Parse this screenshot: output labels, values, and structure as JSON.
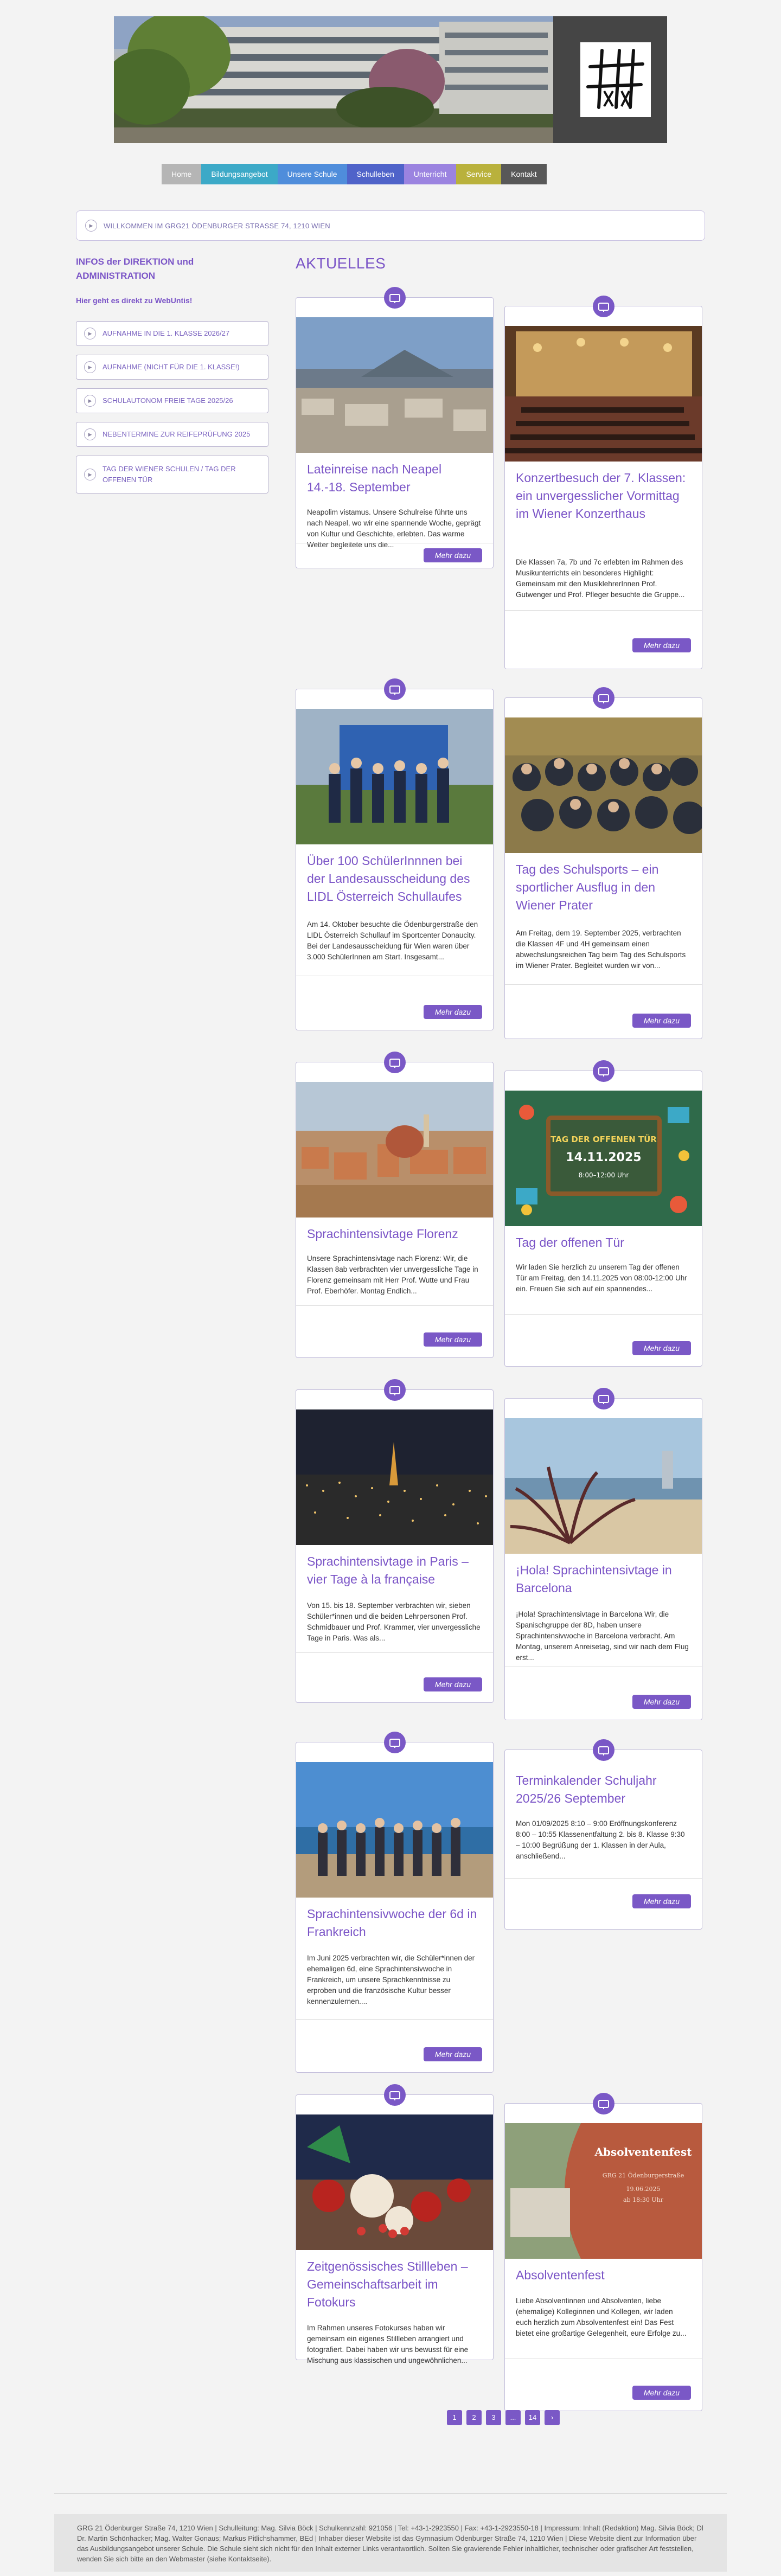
{
  "nav": [
    {
      "label": "Home",
      "color": "#b5b5b5"
    },
    {
      "label": "Bildungsangebot",
      "color": "#3ca9c7"
    },
    {
      "label": "Unsere Schule",
      "color": "#4f8ddb"
    },
    {
      "label": "Schulleben",
      "color": "#4f63c9"
    },
    {
      "label": "Unterricht",
      "color": "#9b83e0"
    },
    {
      "label": "Service",
      "color": "#b9b13c"
    },
    {
      "label": "Kontakt",
      "color": "#585858"
    }
  ],
  "welcome": "WILLKOMMEN IM GRG21 ÖDENBURGER STRASSE 74, 1210 WIEN",
  "sidebar": {
    "title": "INFOS der DIREKTION und ADMINISTRATION",
    "subtitle": "Hier geht es direkt zu WebUntis!",
    "links": [
      "AUFNAHME IN DIE 1. KLASSE 2026/27",
      "AUFNAHME (NICHT FÜR DIE 1. KLASSE!)",
      "SCHULAUTONOM FREIE TAGE 2025/26",
      "NEBENTERMINE ZUR REIFEPRÜFUNG 2025",
      "TAG DER WIENER SCHULEN / TAG DER OFFENEN TÜR"
    ]
  },
  "main_title": "AKTUELLES",
  "more_label": "Mehr dazu",
  "posts": [
    {
      "title": "Lateinreise nach Neapel 14.-18. September",
      "text": "Neapolim vistamus. Unsere Schulreise führte uns nach Neapel, wo wir eine spannende Woche, geprägt von Kultur und Geschichte, erlebten. Das warme Wetter begleitete uns die..."
    },
    {
      "title": "Konzertbesuch der 7. Klassen: ein unvergesslicher Vormittag im Wiener Konzerthaus",
      "text": "Die Klassen 7a, 7b und 7c erlebten im Rahmen des Musikunterrichts ein besonderes Highlight: Gemeinsam mit den MusiklehrerInnen Prof. Gutwenger und Prof. Pfleger besuchte die Gruppe..."
    },
    {
      "title": "Über 100 SchülerInnnen bei der Landesausscheidung des LIDL Österreich Schullaufes",
      "text": "Am 14. Oktober besuchte die Ödenburgerstraße den LIDL Österreich Schullauf im Sportcenter Donaucity. Bei der Landesausscheidung für Wien waren über 3.000 SchülerInnen am Start. Insgesamt..."
    },
    {
      "title": "Tag des Schulsports – ein sportlicher Ausflug in den Wiener Prater",
      "text": "Am Freitag, dem 19. September 2025, verbrachten die Klassen 4F und 4H gemeinsam einen abwechslungsreichen Tag beim Tag des Schulsports im Wiener Prater. Begleitet wurden wir von..."
    },
    {
      "title": "Sprachintensivtage Florenz",
      "text": "Unsere Sprachintensivtage nach Florenz: Wir, die Klassen 8ab verbrachten vier unvergessliche Tage in Florenz gemeinsam mit Herr Prof. Wutte und Frau Prof. Eberhöfer. Montag Endlich..."
    },
    {
      "title": "Tag der offenen Tür",
      "text": "Wir laden Sie herzlich zu unserem Tag der offenen Tür am Freitag, den 14.11.2025 von 08:00-12:00 Uhr ein. Freuen Sie sich auf ein spannendes..."
    },
    {
      "title": "Sprachintensivtage in Paris – vier Tage à la française",
      "text": "Von 15. bis 18. September verbrachten wir, sieben Schüler*innen und die beiden Lehrpersonen Prof. Schmidbauer und Prof. Krammer, vier unvergessliche Tage in Paris. Was als..."
    },
    {
      "title": "¡Hola! Sprachintensivtage in Barcelona",
      "text": "¡Hola! Sprachintensivtage in Barcelona Wir, die Spanischgruppe der 8D, haben unsere Sprachintensivwoche in Barcelona verbracht. Am Montag, unserem Anreisetag, sind wir nach dem Flug erst..."
    },
    {
      "title": "Sprachintensivwoche der 6d in Frankreich",
      "text": "Im Juni 2025 verbrachten wir, die Schüler*innen der ehemaligen 6d, eine Sprachintensivwoche in Frankreich, um unsere Sprachkenntnisse zu erproben und die französische Kultur besser kennenzulernen...."
    },
    {
      "title": "Terminkalender Schuljahr 2025/26 September",
      "text": "Mon 01/09/2025 8:10 – 9:00 Eröffnungskonferenz 8:00 – 10:55 Klassenentfaltung 2. bis 8. Klasse 9:30 – 10:00 Begrüßung der 1. Klassen in der Aula, anschließend..."
    },
    {
      "title": "Zeitgenössisches Stillleben – Gemeinschaftsarbeit im Fotokurs",
      "text": "Im Rahmen unseres Fotokurses haben wir gemeinsam ein eigenes Stillleben arrangiert und fotografiert. Dabei haben wir uns bewusst für eine Mischung aus klassischen und ungewöhnlichen..."
    },
    {
      "title": "Absolventenfest",
      "text": "Liebe Absolventinnen und Absolventen, liebe (ehemalige) Kolleginnen und Kollegen, wir laden euch herzlich zum Absolventenfest ein! Das Fest bietet eine großartige Gelegenheit, eure Erfolge zu..."
    }
  ],
  "poster_tag": {
    "title": "TAG DER OFFENEN TÜR",
    "date": "14.11.2025",
    "time": "8:00–12:00 Uhr"
  },
  "poster_absolventen": {
    "title": "Absolventenfest",
    "line1": "GRG 21 Ödenburgerstraße",
    "line2": "19.06.2025",
    "line3": "ab 18:30 Uhr"
  },
  "pager": [
    "1",
    "2",
    "3",
    "...",
    "14",
    "›"
  ],
  "footer": "GRG 21 Ödenburger Straße 74, 1210 Wien | Schulleitung: Mag. Silvia Böck | Schulkennzahl: 921056 | Tel: +43-1-2923550 | Fax: +43-1-2923550-18 | Impressum: Inhalt (Redaktion) Mag. Silvia Böck; Dl Dr. Martin Schönhacker; Mag. Walter Gonaus; Markus Pitlichshammer, BEd | Inhaber dieser Website ist das Gymnasium Ödenburger Straße 74, 1210 Wien | Diese Website dient zur Information über das Ausbildungsangebot unserer Schule. Die Schule sieht sich nicht für den Inhalt externer Links verantwortlich. Sollten Sie gravierende Fehler inhaltlicher, technischer oder grafischer Art feststellen, wenden Sie sich bitte an den Webmaster (siehe Kontaktseite)."
}
